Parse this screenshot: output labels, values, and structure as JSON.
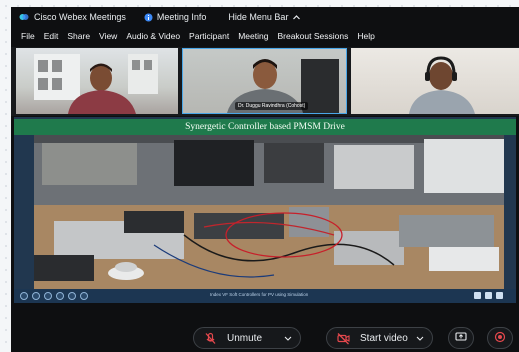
{
  "titlebar": {
    "app_name": "Cisco Webex Meetings",
    "meeting_info": "Meeting Info",
    "hide_menu_bar": "Hide Menu Bar"
  },
  "menu": [
    "File",
    "Edit",
    "Share",
    "View",
    "Audio & Video",
    "Participant",
    "Meeting",
    "Breakout Sessions",
    "Help"
  ],
  "participants": [
    {
      "name": ""
    },
    {
      "name": "Dr. Duggu Ravindhra (Cohost)"
    },
    {
      "name": ""
    }
  ],
  "shared_content": {
    "slide_title": "Synergetic Controller based PMSM Drive",
    "footer_caption": "Index VF Soft Controllers for PV using Simulation"
  },
  "controls": {
    "unmute_label": "Unmute",
    "start_video_label": "Start video"
  },
  "colors": {
    "accent_blue": "#4aa7e8",
    "mute_red": "#e5484d",
    "slide_green": "#1f7a4c",
    "window_bg": "#0e0f11"
  }
}
